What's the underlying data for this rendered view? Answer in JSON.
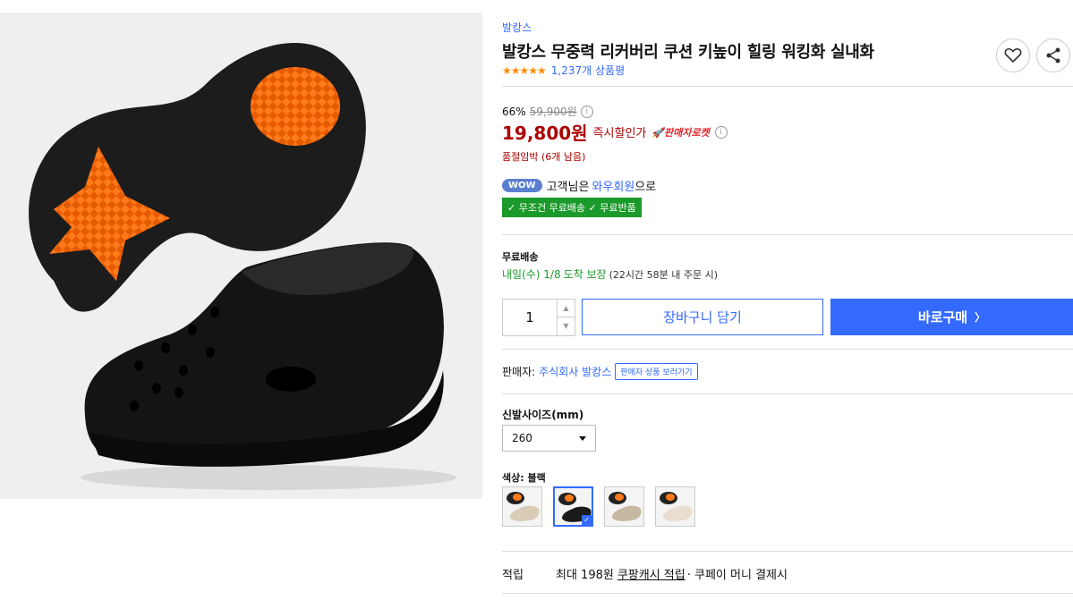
{
  "product": {
    "brand": "발캉스",
    "title": "발캉스 무중력 리커버리 쿠션 키높이 힐링 워킹화 실내화",
    "rating_stars": "★★★★★",
    "review_count": "1,237개 상품평"
  },
  "pricing": {
    "discount_percent": "66%",
    "original_price": "59,900원",
    "sale_price": "19,800원",
    "instant_discount": "즉시할인가",
    "rocket_badge": "🚀판매자로켓",
    "stock_notice": "품절임박 (6개 남음)",
    "info_glyph": "i"
  },
  "membership": {
    "wow_badge": "WOW",
    "prefix": "고객님은",
    "member_link": "와우회원",
    "suffix": "으로",
    "benefits": "✓ 무조건 무료배송 ✓ 무료반품"
  },
  "shipping": {
    "label": "무료배송",
    "delivery_date": "내일(수) 1/8",
    "delivery_guarantee": "도착 보장",
    "cutoff_note": "(22시간 58분 내 주문 시)"
  },
  "purchase": {
    "quantity": "1",
    "qty_up": "▲",
    "qty_down": "▼",
    "cart_label": "장바구니 담기",
    "buy_label": "바로구매",
    "buy_chevron": "〉"
  },
  "seller": {
    "label": "판매자:",
    "name": "주식회사 발캉스",
    "link_label": "판매자 상품 보러가기"
  },
  "options": {
    "size_label": "신발사이즈(mm)",
    "size_value": "260",
    "color_label": "색상: 블랙",
    "selected_check": "✓",
    "swatches": [
      {
        "name": "beige",
        "upper_color": "#d9ccb6",
        "selected": false
      },
      {
        "name": "black",
        "upper_color": "#1a1a1a",
        "selected": true
      },
      {
        "name": "cream",
        "upper_color": "#c7b8a2",
        "selected": false
      },
      {
        "name": "ivory",
        "upper_color": "#e8ddd0",
        "selected": false
      }
    ]
  },
  "rewards": {
    "label": "적립",
    "max_prefix": "최대 198원",
    "cash_link": "쿠팡캐시 적립",
    "suffix": "· 쿠페이 머니 결제시"
  },
  "colors": {
    "accent_blue": "#346aff",
    "price_red": "#ae0000",
    "green": "#1a9a2a",
    "sole_orange": "#ff7a1a"
  },
  "icons": {
    "wishlist": "heart-icon",
    "share": "share-icon"
  }
}
